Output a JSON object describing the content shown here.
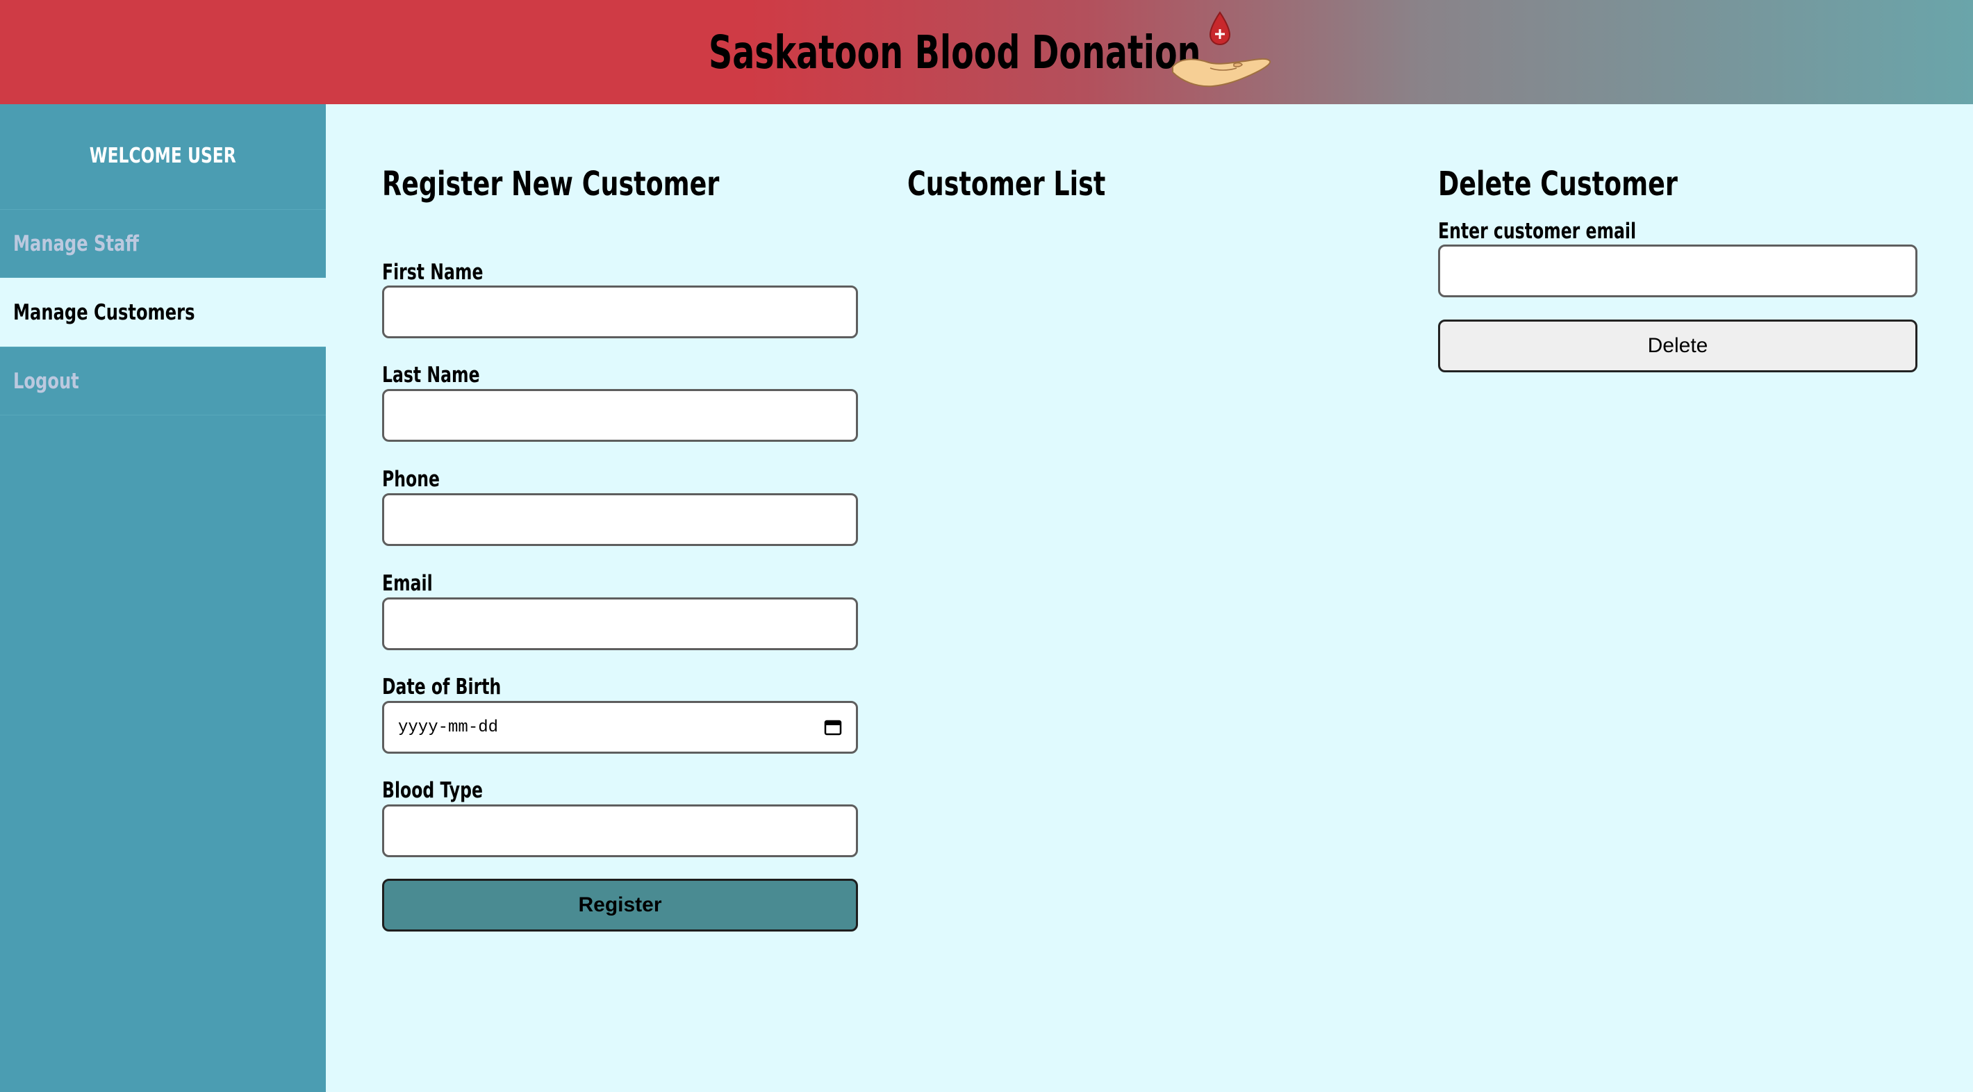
{
  "header": {
    "title": "Saskatoon Blood Donation",
    "logo_icon": "blood-drop-hand-icon"
  },
  "sidebar": {
    "welcome": "WELCOME USER",
    "items": [
      {
        "label": "Manage Staff",
        "active": false
      },
      {
        "label": "Manage Customers",
        "active": true
      },
      {
        "label": "Logout",
        "active": false
      }
    ]
  },
  "register": {
    "title": "Register New Customer",
    "fields": {
      "first_name": {
        "label": "First Name",
        "value": ""
      },
      "last_name": {
        "label": "Last Name",
        "value": ""
      },
      "phone": {
        "label": "Phone",
        "value": ""
      },
      "email": {
        "label": "Email",
        "value": ""
      },
      "dob": {
        "label": "Date of Birth",
        "placeholder": "yyyy-mm-dd"
      },
      "blood_type": {
        "label": "Blood Type",
        "value": ""
      }
    },
    "submit_label": "Register"
  },
  "customer_list": {
    "title": "Customer List",
    "items": []
  },
  "delete": {
    "title": "Delete Customer",
    "email_label": "Enter customer email",
    "email_value": "",
    "button_label": "Delete"
  },
  "colors": {
    "header_red": "#cf3b45",
    "header_teal": "#6aa5aa",
    "sidebar": "#4b9db2",
    "content_bg": "#e0fafe",
    "register_button": "#4a8b92"
  }
}
